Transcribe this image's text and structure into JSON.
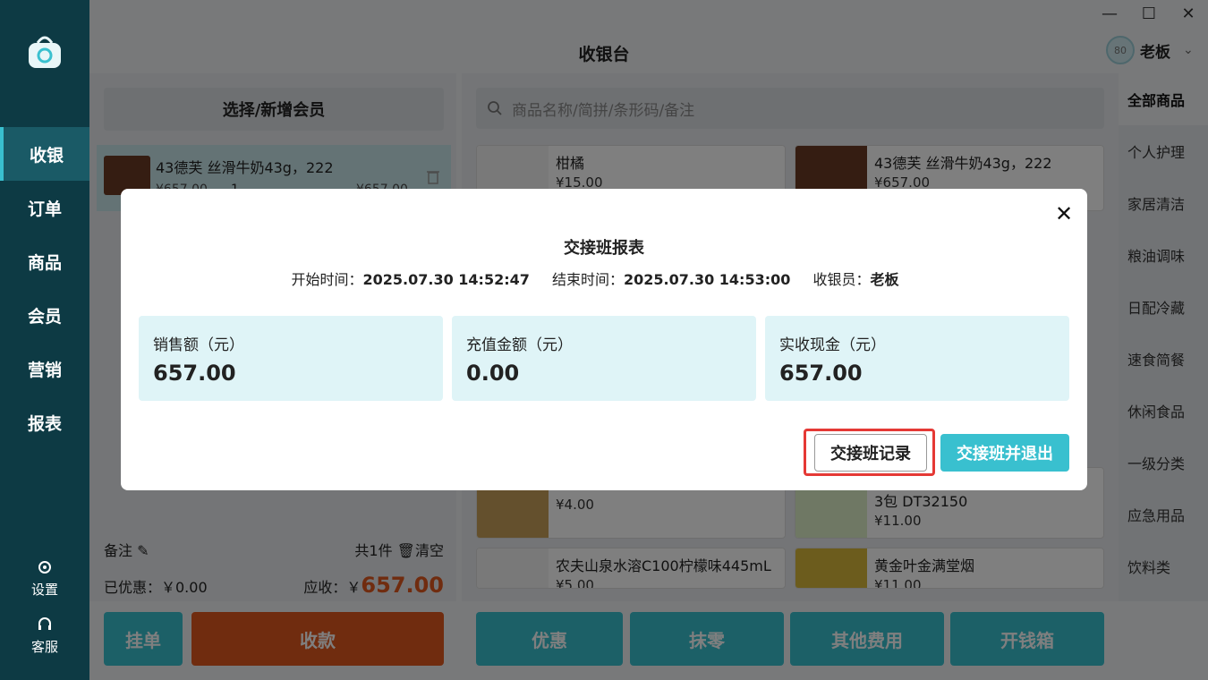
{
  "app": {
    "title": "收银台"
  },
  "user": {
    "name": "老板",
    "avatar_text": "80"
  },
  "nav": {
    "items": [
      "收银",
      "订单",
      "商品",
      "会员",
      "营销",
      "报表"
    ],
    "settings_label": "设置",
    "service_label": "客服"
  },
  "cart": {
    "member_button": "选择/新增会员",
    "items": [
      {
        "name": "43德芙 丝滑牛奶43g，222",
        "price": "¥657.00",
        "qty": "1",
        "total": "¥657.00"
      }
    ],
    "remark_label": "备注",
    "count_label": "共1件",
    "clear_label": "清空",
    "discount_label": "已优惠：￥0.00",
    "due_label": "应收：￥",
    "due_value": "657.00"
  },
  "actions": {
    "hold": "挂单",
    "checkout": "收款",
    "discount": "优惠",
    "round": "抹零",
    "other_fees": "其他费用",
    "open_drawer": "开钱箱"
  },
  "search": {
    "placeholder": "商品名称/简拼/条形码/备注"
  },
  "products": [
    {
      "name": "柑橘",
      "price": "¥15.00"
    },
    {
      "name": "43德芙 丝滑牛奶43g，222",
      "price": "¥657.00"
    },
    {
      "name": "",
      "price": "¥4.00"
    },
    {
      "name": "3包 DT32150",
      "price": "¥11.00"
    },
    {
      "name": "农夫山泉水溶C100柠檬味445mL",
      "price": "¥5.00"
    },
    {
      "name": "黄金叶金满堂烟",
      "price": "¥11.00"
    }
  ],
  "categories": [
    "全部商品",
    "个人护理",
    "家居清洁",
    "粮油调味",
    "日配冷藏",
    "速食简餐",
    "休闲食品",
    "一级分类",
    "应急用品",
    "饮料类"
  ],
  "modal": {
    "title": "交接班报表",
    "start_label": "开始时间：",
    "start_value": "2025.07.30 14:52:47",
    "end_label": "结束时间：",
    "end_value": "2025.07.30 14:53:00",
    "cashier_label": "收银员：",
    "cashier_value": "老板",
    "stats": [
      {
        "label": "销售额（元）",
        "value": "657.00"
      },
      {
        "label": "充值金额（元）",
        "value": "0.00"
      },
      {
        "label": "实收现金（元）",
        "value": "657.00"
      }
    ],
    "records_button": "交接班记录",
    "exit_button": "交接班并退出"
  },
  "colors": {
    "nav_bg": "#0d3a44",
    "accent": "#39c0cf",
    "checkout": "#e0581f",
    "highlight": "#e53935"
  }
}
